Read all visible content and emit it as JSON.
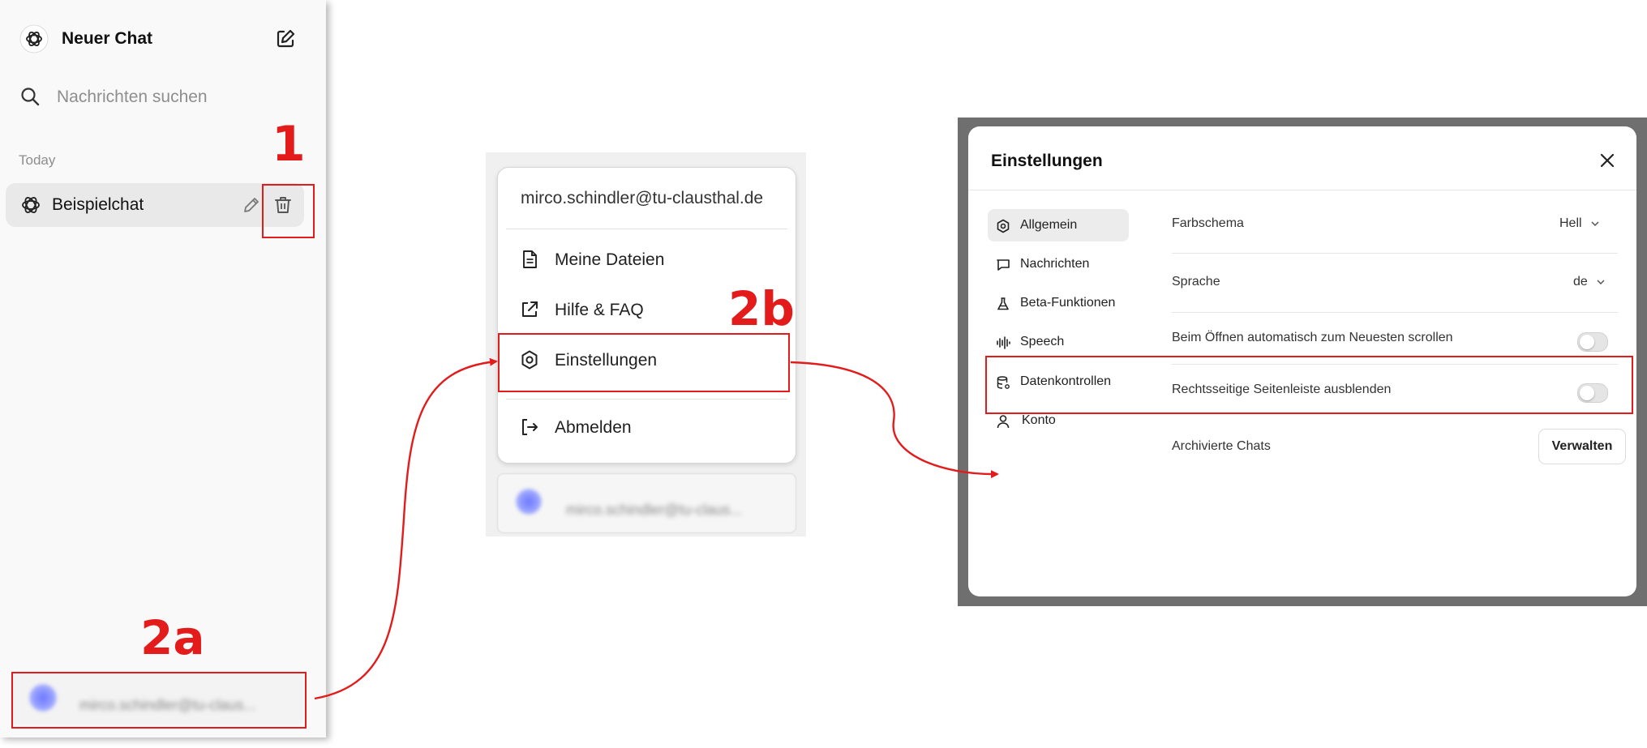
{
  "sidebar": {
    "title": "Neuer Chat",
    "search_placeholder": "Nachrichten suchen",
    "section_label": "Today",
    "chat_item": "Beispielchat",
    "user_email_blurred": "mirco.schindler@tu-claus..."
  },
  "menu": {
    "email": "mirco.schindler@tu-clausthal.de",
    "items": [
      {
        "label": "Meine Dateien",
        "icon": "file-icon"
      },
      {
        "label": "Hilfe & FAQ",
        "icon": "external-link-icon"
      },
      {
        "label": "Einstellungen",
        "icon": "gear-icon"
      },
      {
        "label": "Abmelden",
        "icon": "logout-icon"
      }
    ],
    "user_email_blurred": "mirco.schindler@tu-claus..."
  },
  "settings": {
    "title": "Einstellungen",
    "nav": [
      {
        "label": "Allgemein",
        "icon": "gear-icon",
        "active": true
      },
      {
        "label": "Nachrichten",
        "icon": "message-icon"
      },
      {
        "label": "Beta-Funktionen",
        "icon": "flask-icon"
      },
      {
        "label": "Speech",
        "icon": "audio-wave-icon"
      },
      {
        "label": "Datenkontrollen",
        "icon": "database-icon"
      },
      {
        "label": "Konto",
        "icon": "user-icon"
      }
    ],
    "rows": {
      "color_scheme": {
        "label": "Farbschema",
        "value": "Hell"
      },
      "language": {
        "label": "Sprache",
        "value": "de"
      },
      "auto_scroll": {
        "label": "Beim Öffnen automatisch zum Neuesten scrollen",
        "enabled": false
      },
      "hide_sidebar": {
        "label": "Rechtsseitige Seitenleiste ausblenden",
        "enabled": false
      },
      "archived": {
        "label": "Archivierte Chats",
        "button": "Verwalten"
      }
    }
  },
  "annotations": {
    "step1": "1",
    "step2a": "2a",
    "step2b": "2b",
    "highlight_color": "#e31b1b"
  }
}
